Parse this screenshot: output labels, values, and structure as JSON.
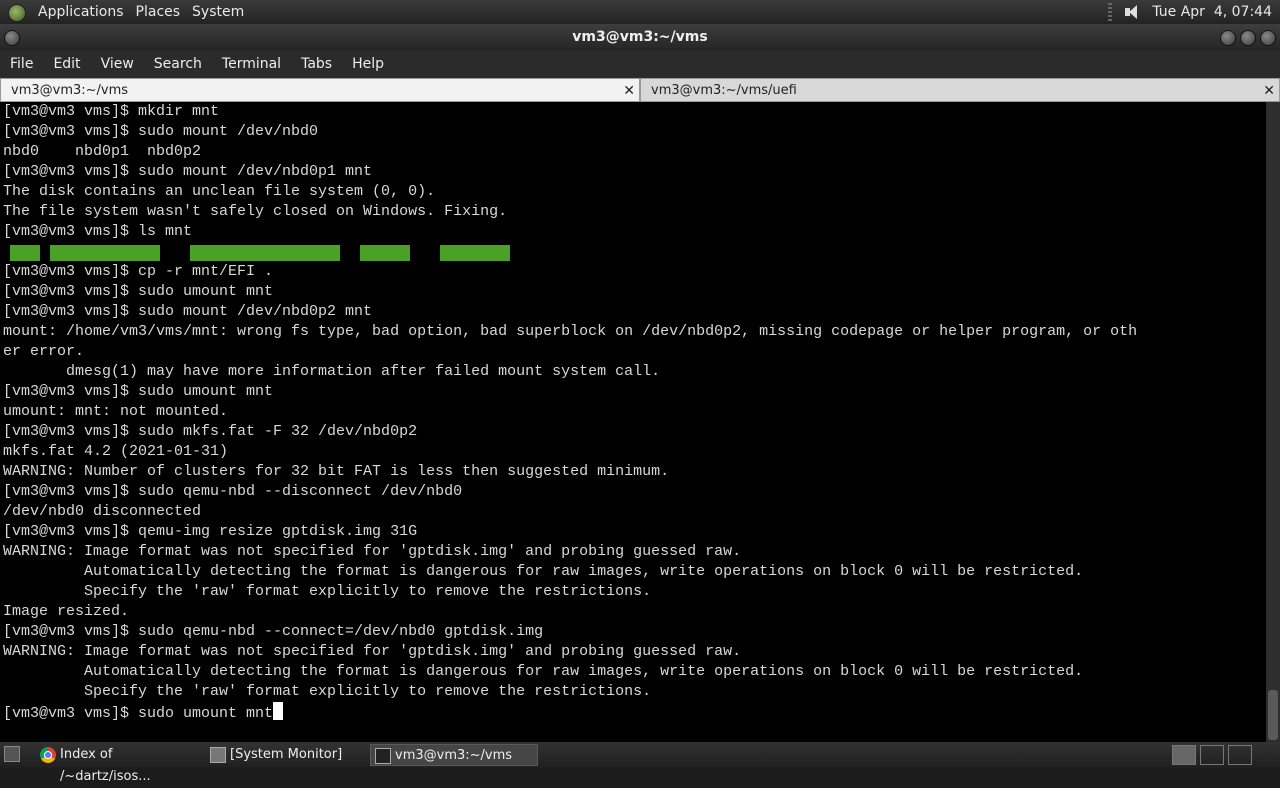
{
  "top_panel": {
    "menus": [
      "Applications",
      "Places",
      "System"
    ],
    "clock": "Tue Apr  4, 07:44"
  },
  "window": {
    "title": "vm3@vm3:~/vms",
    "menubar": [
      "File",
      "Edit",
      "View",
      "Search",
      "Terminal",
      "Tabs",
      "Help"
    ],
    "tabs": [
      {
        "label": "vm3@vm3:~/vms",
        "close": "✕"
      },
      {
        "label": "vm3@vm3:~/vms/uefi",
        "close": "✕"
      }
    ]
  },
  "terminal": {
    "lines": [
      "[vm3@vm3 vms]$ mkdir mnt",
      "[vm3@vm3 vms]$ sudo mount /dev/nbd0",
      "nbd0    nbd0p1  nbd0p2",
      "[vm3@vm3 vms]$ sudo mount /dev/nbd0p1 mnt",
      "The disk contains an unclean file system (0, 0).",
      "The file system wasn't safely closed on Windows. Fixing.",
      "[vm3@vm3 vms]$ ls mnt",
      "",
      "[vm3@vm3 vms]$ cp -r mnt/EFI .",
      "[vm3@vm3 vms]$ sudo umount mnt",
      "[vm3@vm3 vms]$ sudo mount /dev/nbd0p2 mnt",
      "mount: /home/vm3/vms/mnt: wrong fs type, bad option, bad superblock on /dev/nbd0p2, missing codepage or helper program, or oth",
      "er error.",
      "       dmesg(1) may have more information after failed mount system call.",
      "[vm3@vm3 vms]$ sudo umount mnt",
      "umount: mnt: not mounted.",
      "[vm3@vm3 vms]$ sudo mkfs.fat -F 32 /dev/nbd0p2",
      "mkfs.fat 4.2 (2021-01-31)",
      "WARNING: Number of clusters for 32 bit FAT is less then suggested minimum.",
      "[vm3@vm3 vms]$ sudo qemu-nbd --disconnect /dev/nbd0",
      "/dev/nbd0 disconnected",
      "[vm3@vm3 vms]$ qemu-img resize gptdisk.img 31G",
      "WARNING: Image format was not specified for 'gptdisk.img' and probing guessed raw.",
      "         Automatically detecting the format is dangerous for raw images, write operations on block 0 will be restricted.",
      "         Specify the 'raw' format explicitly to remove the restrictions.",
      "Image resized.",
      "[vm3@vm3 vms]$ sudo qemu-nbd --connect=/dev/nbd0 gptdisk.img",
      "WARNING: Image format was not specified for 'gptdisk.img' and probing guessed raw.",
      "         Automatically detecting the format is dangerous for raw images, write operations on block 0 will be restricted.",
      "         Specify the 'raw' format explicitly to remove the restrictions.",
      "[vm3@vm3 vms]$ sudo umount mnt"
    ],
    "highlight_line_index": 7,
    "highlight_color": "#4aa126"
  },
  "taskbar": {
    "tasks": [
      {
        "label": "Index of /~dartz/isos...",
        "icon": "chrome-icon"
      },
      {
        "label": "[System Monitor]",
        "icon": "system-monitor-icon"
      },
      {
        "label": "vm3@vm3:~/vms",
        "icon": "terminal-icon"
      }
    ]
  }
}
